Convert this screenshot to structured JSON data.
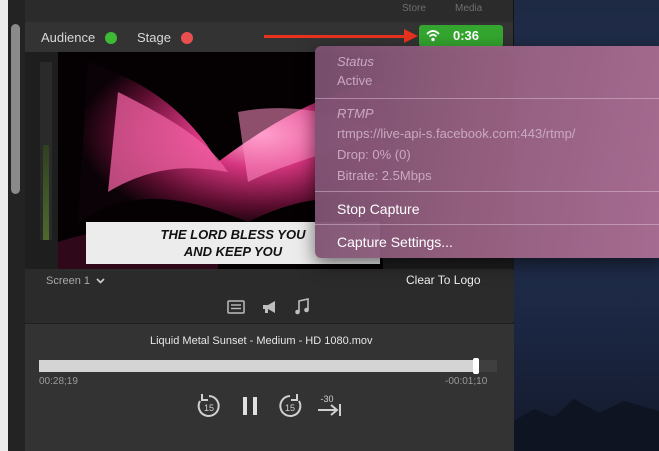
{
  "top_tabs": {
    "store": "Store",
    "media": "Media"
  },
  "header": {
    "audience_label": "Audience",
    "stage_label": "Stage",
    "live_time": "0:36",
    "colors": {
      "audience_dot": "#3dbb35",
      "stage_dot": "#e94f4f",
      "live_badge": "#34a62f",
      "annotation_arrow": "#e8321e"
    }
  },
  "preview": {
    "lyric_line1": "THE LORD BLESS YOU",
    "lyric_line2": "AND KEEP YOU",
    "screen_selector": "Screen 1",
    "clear_to_logo": "Clear To Logo"
  },
  "popup": {
    "status_heading": "Status",
    "status_value": "Active",
    "rtmp_heading": "RTMP",
    "rtmp_url": "rtmps://live-api-s.facebook.com:443/rtmp/",
    "drop": "Drop: 0% (0)",
    "bitrate": "Bitrate: 2.5Mbps",
    "stop_capture": "Stop Capture",
    "capture_settings": "Capture Settings..."
  },
  "media": {
    "title": "Liquid Metal Sunset - Medium - HD 1080.mov",
    "elapsed": "00:28;19",
    "remaining": "-00:01;10",
    "progress_fraction": 0.955,
    "skip_back_seconds": "15",
    "skip_forward_seconds": "15",
    "jump_label": "-30"
  },
  "icons": [
    "list-icon",
    "megaphone-icon",
    "music-note-icon",
    "skip-back-icon",
    "pause-icon",
    "skip-forward-icon",
    "jump-to-end-icon",
    "wifi-icon",
    "chevron-down-icon"
  ]
}
